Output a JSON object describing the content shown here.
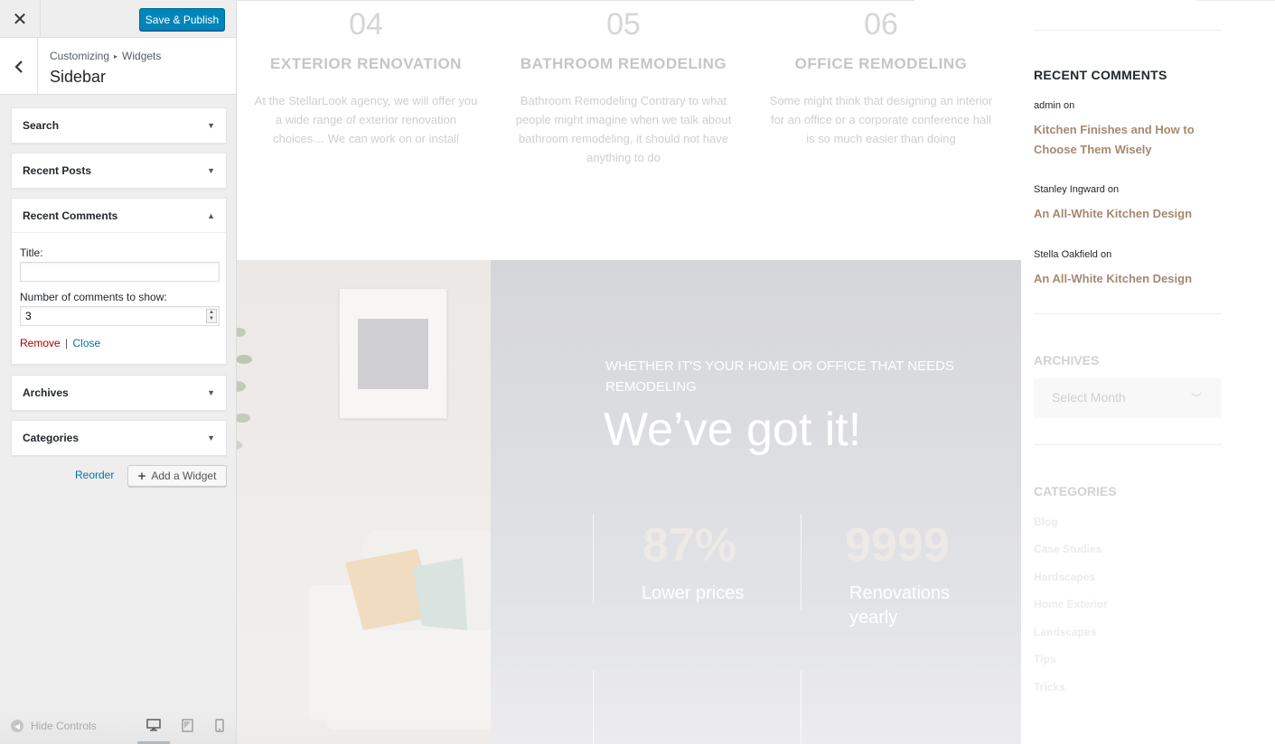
{
  "panel": {
    "close_symbol": "✕",
    "publish_label": "Save & Publish",
    "breadcrumb": [
      "Customizing",
      "Widgets"
    ],
    "breadcrumb_sep": "▸",
    "section_title": "Sidebar",
    "widgets": [
      {
        "title": "Search",
        "arrow": "▼"
      },
      {
        "title": "Recent Posts",
        "arrow": "▼"
      },
      {
        "title": "Recent Comments",
        "arrow": "▲"
      },
      {
        "title": "Archives",
        "arrow": "▼"
      },
      {
        "title": "Categories",
        "arrow": "▼"
      }
    ],
    "form": {
      "title_label": "Title:",
      "title_value": "",
      "number_label": "Number of comments to show:",
      "number_value": "3",
      "remove_label": "Remove",
      "separator": "|",
      "close_label": "Close"
    },
    "reorder_label": "Reorder",
    "add_widget_label": "Add a Widget",
    "add_symbol": "+",
    "hide_controls_label": "Hide Controls",
    "hide_symbol": "◀",
    "icons": {
      "close": "close-icon",
      "back": "chevron-left-icon",
      "desktop": "desktop-icon",
      "tablet": "tablet-icon",
      "mobile": "mobile-icon"
    },
    "colors": {
      "primary": "#0085ba",
      "link": "#0073aa",
      "danger": "#a00"
    }
  },
  "preview": {
    "services": [
      {
        "num": "04",
        "name": "EXTERIOR RENOVATION",
        "desc": "At the StellarLook agency, we will offer you a wide range of exterior renovation choices… We can work on or install"
      },
      {
        "num": "05",
        "name": "BATHROOM REMODELING",
        "desc": "Bathroom Remodeling Contrary to what people might imagine when we talk about bathroom remodeling, it should not have anything to do"
      },
      {
        "num": "06",
        "name": "OFFICE REMODELING",
        "desc": "Some might think that designing an interior for an office or a corporate conference hall is so much easier than doing"
      }
    ],
    "hero": {
      "kicker": "WHETHER IT'S YOUR HOME OR OFFICE THAT NEEDS REMODELING",
      "title": "We’ve got it!",
      "stats": [
        {
          "num": "87%",
          "label": "Lower prices"
        },
        {
          "num": "9999",
          "label": "Renovations yearly"
        }
      ]
    },
    "sidebar": {
      "recent_comments_title": "RECENT COMMENTS",
      "comments": [
        {
          "author": "admin on",
          "post": "Kitchen Finishes and How to Choose Them Wisely"
        },
        {
          "author": "Stanley Ingward on",
          "post": "An All-White Kitchen Design"
        },
        {
          "author": "Stella Oakfield on",
          "post": "An All-White Kitchen Design"
        }
      ],
      "archives_title": "ARCHIVES",
      "archives_select": "Select Month",
      "categories_title": "CATEGORIES",
      "categories": [
        "Blog",
        "Case Studies",
        "Hardscapes",
        "Home Exterior",
        "Landscapes",
        "Tips",
        "Tricks"
      ]
    },
    "colors": {
      "accent": "#a5896f"
    }
  }
}
